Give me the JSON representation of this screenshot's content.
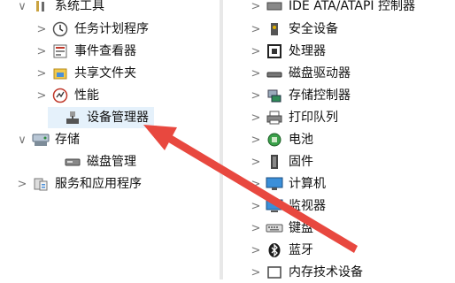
{
  "left_tree": [
    {
      "label": "系统工具",
      "chevron": "∨",
      "icon": "tools-icon"
    },
    {
      "label": "任务计划程序",
      "chevron": ">",
      "icon": "clock-icon"
    },
    {
      "label": "事件查看器",
      "chevron": ">",
      "icon": "event-viewer-icon"
    },
    {
      "label": "共享文件夹",
      "chevron": ">",
      "icon": "shared-folder-icon"
    },
    {
      "label": "性能",
      "chevron": ">",
      "icon": "performance-icon"
    },
    {
      "label": "设备管理器",
      "chevron": "",
      "icon": "device-manager-icon"
    },
    {
      "label": "存储",
      "chevron": "∨",
      "icon": "storage-icon"
    },
    {
      "label": "磁盘管理",
      "chevron": "",
      "icon": "disk-management-icon"
    },
    {
      "label": "服务和应用程序",
      "chevron": ">",
      "icon": "services-icon"
    }
  ],
  "right_tree": [
    {
      "label": "IDE ATA/ATAPI 控制器",
      "icon": "ide-controller-icon"
    },
    {
      "label": "安全设备",
      "icon": "security-device-icon"
    },
    {
      "label": "处理器",
      "icon": "processor-icon"
    },
    {
      "label": "磁盘驱动器",
      "icon": "disk-drive-icon"
    },
    {
      "label": "存储控制器",
      "icon": "storage-controller-icon"
    },
    {
      "label": "打印队列",
      "icon": "printer-icon"
    },
    {
      "label": "电池",
      "icon": "battery-icon"
    },
    {
      "label": "固件",
      "icon": "firmware-icon"
    },
    {
      "label": "计算机",
      "icon": "computer-icon"
    },
    {
      "label": "监视器",
      "icon": "monitor-icon"
    },
    {
      "label": "键盘",
      "icon": "keyboard-icon"
    },
    {
      "label": "蓝牙",
      "icon": "bluetooth-icon"
    },
    {
      "label": "内存技术设备",
      "icon": "memory-device-icon"
    }
  ],
  "right_chevron": ">",
  "colors": {
    "arrow": "#e8483f",
    "selection": "#e5f1fb"
  }
}
